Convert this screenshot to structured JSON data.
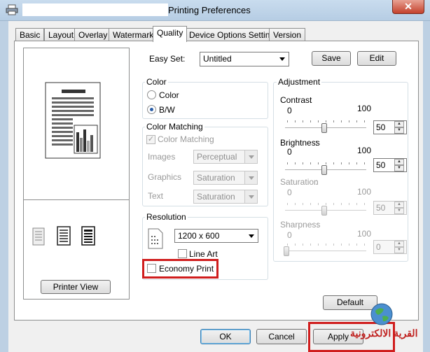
{
  "window": {
    "title": "Printing Preferences",
    "close_glyph": "✕"
  },
  "tabs": [
    "Basic",
    "Layout",
    "Overlay",
    "Watermark",
    "Quality",
    "Device Options Setting",
    "Version"
  ],
  "active_tab": "Quality",
  "easy_set": {
    "label": "Easy Set:",
    "value": "Untitled",
    "save": "Save",
    "edit": "Edit"
  },
  "color": {
    "group": "Color",
    "option_color": "Color",
    "option_bw": "B/W",
    "selected": "B/W"
  },
  "color_matching": {
    "group": "Color Matching",
    "checkbox": "Color Matching",
    "images_label": "Images",
    "images_value": "Perceptual",
    "graphics_label": "Graphics",
    "graphics_value": "Saturation",
    "text_label": "Text",
    "text_value": "Saturation"
  },
  "resolution": {
    "group": "Resolution",
    "value": "1200 x 600",
    "line_art": "Line Art",
    "economy_print": "Economy Print"
  },
  "adjustment": {
    "group": "Adjustment",
    "sliders": [
      {
        "label": "Contrast",
        "min": "0",
        "max": "100",
        "value": "50",
        "fraction": 0.5,
        "enabled": true
      },
      {
        "label": "Brightness",
        "min": "0",
        "max": "100",
        "value": "50",
        "fraction": 0.5,
        "enabled": true
      },
      {
        "label": "Saturation",
        "min": "0",
        "max": "100",
        "value": "50",
        "fraction": 0.5,
        "enabled": false
      },
      {
        "label": "Sharpness",
        "min": "0",
        "max": "100",
        "value": "0",
        "fraction": 0.0,
        "enabled": false
      }
    ],
    "default_button": "Default"
  },
  "printer_view_button": "Printer View",
  "buttons": {
    "ok": "OK",
    "cancel": "Cancel",
    "apply": "Apply"
  },
  "watermark_text": "القرية الالكترونية",
  "highlight_color": "#d01d1d",
  "accent_color": "#2a5ea8"
}
